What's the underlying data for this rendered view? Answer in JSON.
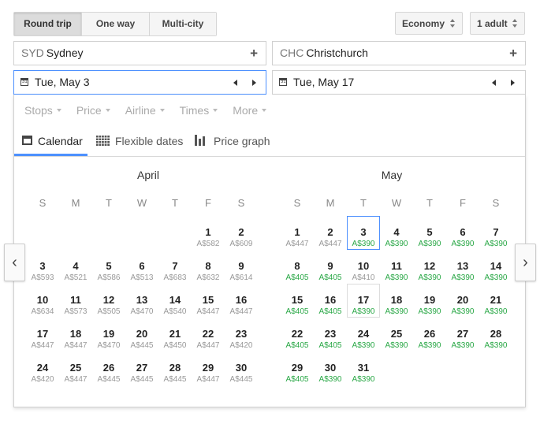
{
  "trip_type": {
    "options": [
      "Round trip",
      "One way",
      "Multi-city"
    ],
    "selected": 0
  },
  "cabin_class": "Economy",
  "passengers": "1 adult",
  "origin": {
    "code": "SYD",
    "city": "Sydney"
  },
  "destination": {
    "code": "CHC",
    "city": "Christchurch"
  },
  "depart_date": "Tue, May 3",
  "return_date": "Tue, May 17",
  "filters": [
    "Stops",
    "Price",
    "Airline",
    "Times",
    "More"
  ],
  "view_tabs": [
    "Calendar",
    "Flexible dates",
    "Price graph"
  ],
  "selected_view": "Calendar",
  "weekday_headers": [
    "S",
    "M",
    "T",
    "W",
    "T",
    "F",
    "S"
  ],
  "nav": {
    "prev": "‹",
    "next": "›"
  },
  "colors": {
    "accent": "#4d90fe",
    "price_low": "#28a745",
    "price_normal": "#999999"
  },
  "months": [
    {
      "name": "April",
      "first_weekday": 5,
      "days": [
        {
          "d": "1",
          "price": "A$582"
        },
        {
          "d": "2",
          "price": "A$609"
        },
        {
          "d": "3",
          "price": "A$593"
        },
        {
          "d": "4",
          "price": "A$521"
        },
        {
          "d": "5",
          "price": "A$586"
        },
        {
          "d": "6",
          "price": "A$513"
        },
        {
          "d": "7",
          "price": "A$683"
        },
        {
          "d": "8",
          "price": "A$632"
        },
        {
          "d": "9",
          "price": "A$614"
        },
        {
          "d": "10",
          "price": "A$634"
        },
        {
          "d": "11",
          "price": "A$573"
        },
        {
          "d": "12",
          "price": "A$505"
        },
        {
          "d": "13",
          "price": "A$470"
        },
        {
          "d": "14",
          "price": "A$540"
        },
        {
          "d": "15",
          "price": "A$447"
        },
        {
          "d": "16",
          "price": "A$447"
        },
        {
          "d": "17",
          "price": "A$447"
        },
        {
          "d": "18",
          "price": "A$447"
        },
        {
          "d": "19",
          "price": "A$470"
        },
        {
          "d": "20",
          "price": "A$445"
        },
        {
          "d": "21",
          "price": "A$450"
        },
        {
          "d": "22",
          "price": "A$447"
        },
        {
          "d": "23",
          "price": "A$420"
        },
        {
          "d": "24",
          "price": "A$420"
        },
        {
          "d": "25",
          "price": "A$447"
        },
        {
          "d": "26",
          "price": "A$445"
        },
        {
          "d": "27",
          "price": "A$445"
        },
        {
          "d": "28",
          "price": "A$445"
        },
        {
          "d": "29",
          "price": "A$447"
        },
        {
          "d": "30",
          "price": "A$445"
        }
      ]
    },
    {
      "name": "May",
      "first_weekday": 0,
      "days": [
        {
          "d": "1",
          "price": "A$447"
        },
        {
          "d": "2",
          "price": "A$447"
        },
        {
          "d": "3",
          "price": "A$390",
          "low": true,
          "state": "depart"
        },
        {
          "d": "4",
          "price": "A$390",
          "low": true
        },
        {
          "d": "5",
          "price": "A$390",
          "low": true
        },
        {
          "d": "6",
          "price": "A$390",
          "low": true
        },
        {
          "d": "7",
          "price": "A$390",
          "low": true
        },
        {
          "d": "8",
          "price": "A$405",
          "low": true
        },
        {
          "d": "9",
          "price": "A$405",
          "low": true
        },
        {
          "d": "10",
          "price": "A$410"
        },
        {
          "d": "11",
          "price": "A$390",
          "low": true
        },
        {
          "d": "12",
          "price": "A$390",
          "low": true
        },
        {
          "d": "13",
          "price": "A$390",
          "low": true
        },
        {
          "d": "14",
          "price": "A$390",
          "low": true
        },
        {
          "d": "15",
          "price": "A$405",
          "low": true
        },
        {
          "d": "16",
          "price": "A$405",
          "low": true
        },
        {
          "d": "17",
          "price": "A$390",
          "low": true,
          "state": "return"
        },
        {
          "d": "18",
          "price": "A$390",
          "low": true
        },
        {
          "d": "19",
          "price": "A$390",
          "low": true
        },
        {
          "d": "20",
          "price": "A$390",
          "low": true
        },
        {
          "d": "21",
          "price": "A$390",
          "low": true
        },
        {
          "d": "22",
          "price": "A$405",
          "low": true
        },
        {
          "d": "23",
          "price": "A$405",
          "low": true
        },
        {
          "d": "24",
          "price": "A$390",
          "low": true
        },
        {
          "d": "25",
          "price": "A$390",
          "low": true
        },
        {
          "d": "26",
          "price": "A$390",
          "low": true
        },
        {
          "d": "27",
          "price": "A$390",
          "low": true
        },
        {
          "d": "28",
          "price": "A$390",
          "low": true
        },
        {
          "d": "29",
          "price": "A$405",
          "low": true
        },
        {
          "d": "30",
          "price": "A$390",
          "low": true
        },
        {
          "d": "31",
          "price": "A$390",
          "low": true
        }
      ]
    }
  ]
}
